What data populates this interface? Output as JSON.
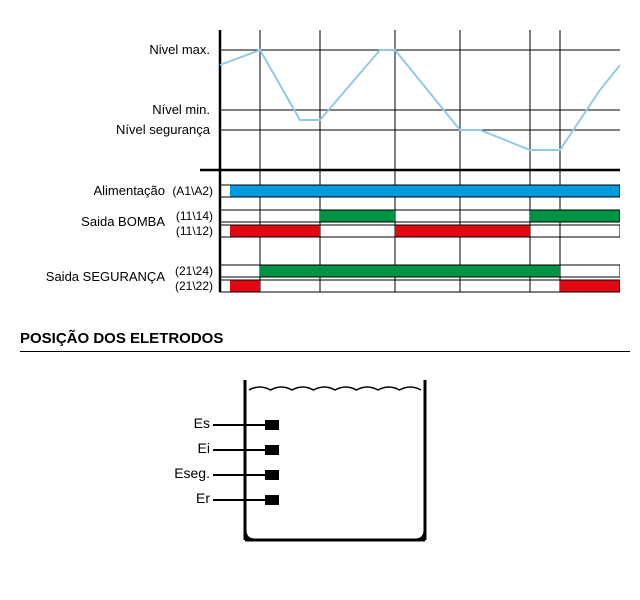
{
  "timing": {
    "level_labels": {
      "max": "Nivel max.",
      "min": "Nível min.",
      "seg": "Nível segurança"
    },
    "rows": {
      "supply": {
        "label": "Alimentação",
        "contacts": "(A1\\A2)"
      },
      "pump": {
        "label": "Saida BOMBA",
        "no": "(11\\14)",
        "nc": "(11\\12)"
      },
      "safety": {
        "label": "Saida SEGURANÇA",
        "no": "(21\\24)",
        "nc": "(21\\22)"
      }
    },
    "colors": {
      "supply": "#009ADE",
      "relay_on": "#009245",
      "relay_off": "#E30613",
      "level": "#93C9E8"
    },
    "chart_data": {
      "type": "timing",
      "time_axis": [
        0,
        40,
        80,
        100,
        160,
        175,
        240,
        260,
        310,
        340,
        380,
        400
      ],
      "level_curve_y": [
        55,
        40,
        110,
        110,
        40,
        40,
        120,
        120,
        140,
        140,
        80,
        55
      ],
      "grid_y": [
        40,
        100,
        120
      ],
      "vlines": [
        40,
        100,
        175,
        240,
        310,
        340
      ],
      "supply_on": [
        [
          10,
          400
        ]
      ],
      "pump_NO_on": [
        [
          100,
          175
        ],
        [
          310,
          400
        ]
      ],
      "pump_NC_on": [
        [
          10,
          100
        ],
        [
          175,
          310
        ]
      ],
      "safety_NO_on": [
        [
          40,
          340
        ]
      ],
      "safety_NC_on": [
        [
          10,
          40
        ],
        [
          340,
          400
        ]
      ]
    }
  },
  "section_title": "POSIÇÃO DOS ELETRODOS",
  "electrodes": {
    "labels": [
      "Es",
      "Ei",
      "Eseg.",
      "Er"
    ]
  }
}
